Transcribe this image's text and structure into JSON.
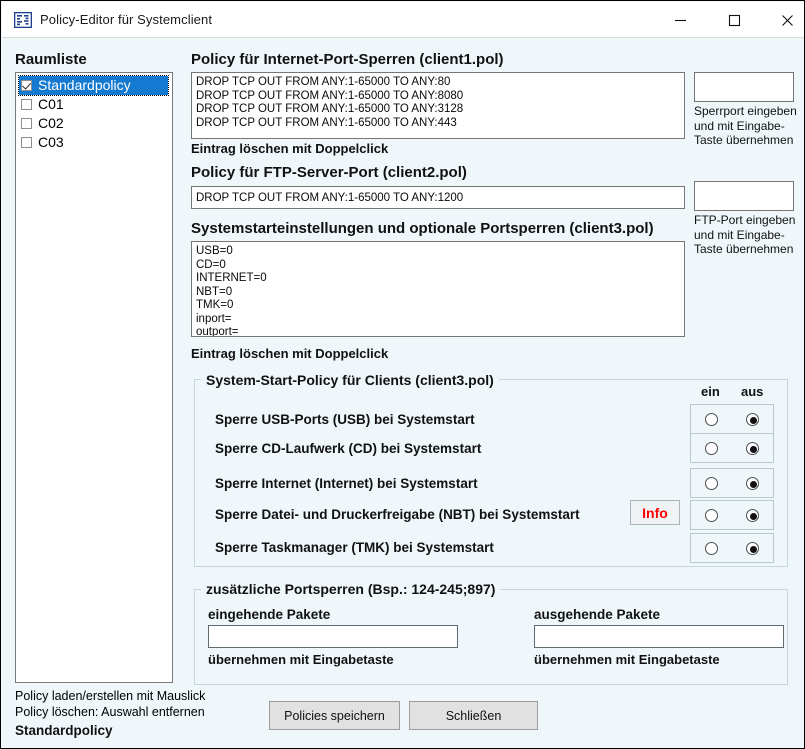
{
  "window": {
    "title": "Policy-Editor für Systemclient",
    "icon": "policy-editor-icon",
    "minimize": "–",
    "maximize": "□",
    "close": "✕",
    "background_color": "#eff7fb"
  },
  "sidebar": {
    "title": "Raumliste",
    "items": [
      {
        "label": "Standardpolicy",
        "checked": true,
        "selected": true
      },
      {
        "label": "C01",
        "checked": false,
        "selected": false
      },
      {
        "label": "C02",
        "checked": false,
        "selected": false
      },
      {
        "label": "C03",
        "checked": false,
        "selected": false
      }
    ],
    "hint1": "Policy laden/erstellen mit Mauslick",
    "hint2": "Policy löschen: Auswahl entfernen",
    "status": "Standardpolicy"
  },
  "section_internet": {
    "title": "Policy für Internet-Port-Sperren (client1.pol)",
    "content": "DROP TCP OUT FROM ANY:1-65000 TO ANY:80\nDROP TCP OUT FROM ANY:1-65000 TO ANY:8080\nDROP TCP OUT FROM ANY:1-65000 TO ANY:3128\nDROP TCP OUT FROM ANY:1-65000 TO ANY:443",
    "note": "Eintrag löschen mit Doppelclick",
    "side_input_value": "",
    "side_label": "Sperrport eingeben und mit Eingabe-Taste übernehmen"
  },
  "section_ftp": {
    "title": "Policy für FTP-Server-Port (client2.pol)",
    "content": "DROP TCP OUT FROM ANY:1-65000 TO ANY:1200",
    "side_input_value": "",
    "side_label": "FTP-Port eingeben und mit Eingabe-Taste übernehmen"
  },
  "section_startup": {
    "title": "Systemstarteinstellungen und optionale Portsperren (client3.pol)",
    "content": "USB=0\nCD=0\nINTERNET=0\nNBT=0\nTMK=0\ninport=\noutport=",
    "note": "Eintrag löschen mit Doppelclick"
  },
  "group_policy": {
    "legend": "System-Start-Policy für Clients (client3.pol)",
    "col_on": "ein",
    "col_off": "aus",
    "info_button": "Info",
    "rows": [
      {
        "label": "Sperre USB-Ports (USB) bei Systemstart",
        "value": "aus"
      },
      {
        "label": "Sperre CD-Laufwerk (CD) bei Systemstart",
        "value": "aus"
      },
      {
        "label": "Sperre Internet (Internet)  bei Systemstart",
        "value": "aus"
      },
      {
        "label": "Sperre Datei- und Druckerfreigabe (NBT) bei Systemstart",
        "value": "aus"
      },
      {
        "label": "Sperre Taskmanager (TMK) bei Systemstart",
        "value": "aus"
      }
    ]
  },
  "group_ports": {
    "legend": "zusätzliche Portsperren (Bsp.: 124-245;897)",
    "incoming_label": "eingehende Pakete",
    "incoming_value": "",
    "incoming_note": "übernehmen mit Eingabetaste",
    "outgoing_label": "ausgehende Pakete",
    "outgoing_value": "",
    "outgoing_note": "übernehmen mit Eingabetaste"
  },
  "footer": {
    "save_button": "Policies speichern",
    "close_button": "Schließen"
  }
}
